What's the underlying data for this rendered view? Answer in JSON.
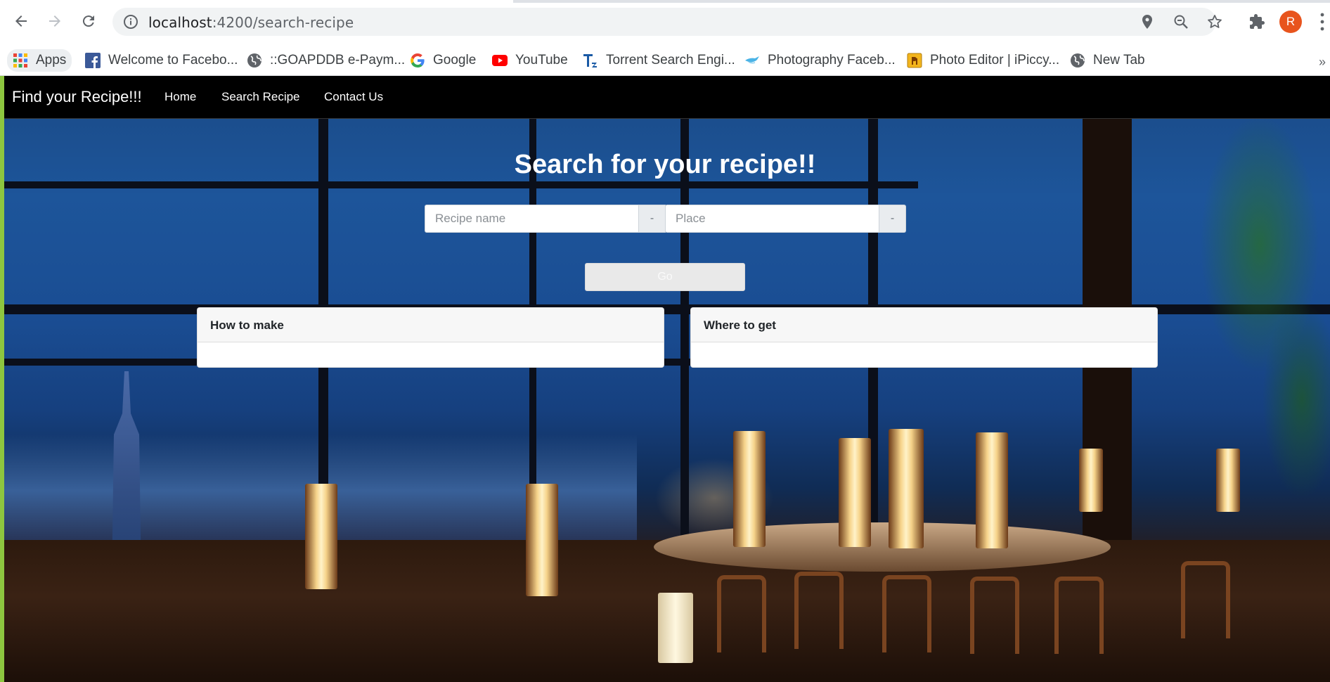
{
  "browser": {
    "url_host": "localhost",
    "url_path": ":4200/search-recipe",
    "profile_initial": "R",
    "bookmarks": [
      {
        "label": "Apps",
        "icon": "apps-grid-icon"
      },
      {
        "label": "Welcome to Facebo...",
        "icon": "facebook-icon"
      },
      {
        "label": "::GOAPDDB e-Paym...",
        "icon": "globe-icon"
      },
      {
        "label": "Google",
        "icon": "google-icon"
      },
      {
        "label": "YouTube",
        "icon": "youtube-icon"
      },
      {
        "label": "Torrent Search Engi...",
        "icon": "torrentz-icon"
      },
      {
        "label": "Photography Faceb...",
        "icon": "bird-icon"
      },
      {
        "label": "Photo Editor | iPiccy...",
        "icon": "ipiccy-icon"
      },
      {
        "label": "New Tab",
        "icon": "globe-icon"
      }
    ],
    "more_bookmarks": "»"
  },
  "navbar": {
    "brand": "Find your Recipe!!!",
    "links": [
      "Home",
      "Search Recipe",
      "Contact Us"
    ]
  },
  "search": {
    "heading": "Search for your recipe!!",
    "recipe_placeholder": "Recipe name",
    "place_placeholder": "Place",
    "addon_symbol": "-",
    "go_label": "Go"
  },
  "cards": {
    "how_to_make": "How to make",
    "where_to_get": "Where to get"
  },
  "colors": {
    "navbar_bg": "#000000",
    "accent_bar": "#8dc63f",
    "avatar": "#e8541d"
  }
}
